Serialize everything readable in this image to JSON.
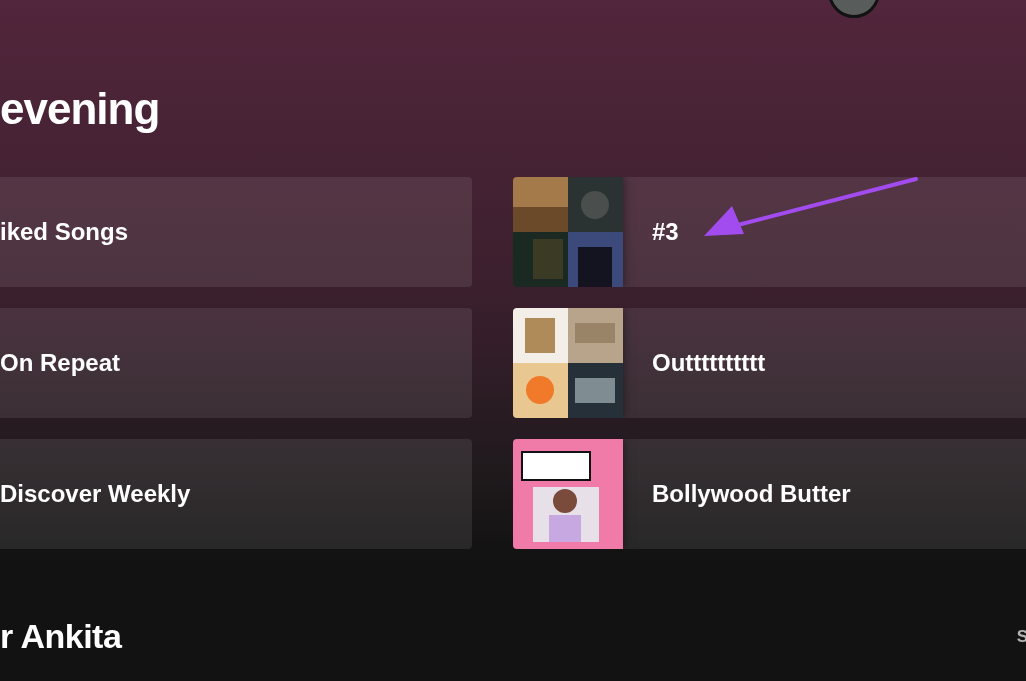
{
  "greeting": "evening",
  "shortcuts": [
    {
      "title": "iked Songs"
    },
    {
      "title": "#3"
    },
    {
      "title": "On Repeat"
    },
    {
      "title": "Outttttttttt"
    },
    {
      "title": "Discover Weekly"
    },
    {
      "title": "Bollywood Butter"
    }
  ],
  "section": {
    "title": "r Ankita",
    "show_all": "S"
  }
}
